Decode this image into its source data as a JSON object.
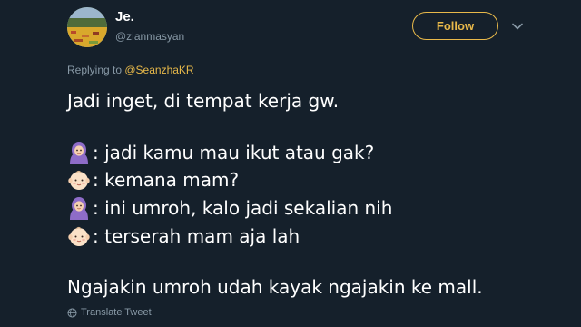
{
  "author": {
    "display_name": "Je.",
    "handle": "@zianmasyan"
  },
  "follow_button": {
    "label": "Follow"
  },
  "reply_context": {
    "prefix": "Replying to ",
    "mention": "@SeanzhaKR"
  },
  "tweet": {
    "intro": "Jadi inget, di tempat kerja gw.",
    "dialog": [
      {
        "speaker_icon": "woman-hijab-emoji",
        "text": ": jadi kamu mau ikut atau gak?"
      },
      {
        "speaker_icon": "baby-face-emoji",
        "text": ": kemana mam?"
      },
      {
        "speaker_icon": "woman-hijab-emoji",
        "text": ": ini umroh, kalo jadi sekalian nih"
      },
      {
        "speaker_icon": "baby-face-emoji",
        "text": ": terserah mam aja lah"
      }
    ],
    "closing": "Ngajakin umroh udah kayak ngajakin ke mall."
  },
  "translate_link": {
    "label": "Translate Tweet"
  },
  "colors": {
    "background": "#15202b",
    "accent": "#e8b94a",
    "secondary_text": "#8899a6"
  }
}
